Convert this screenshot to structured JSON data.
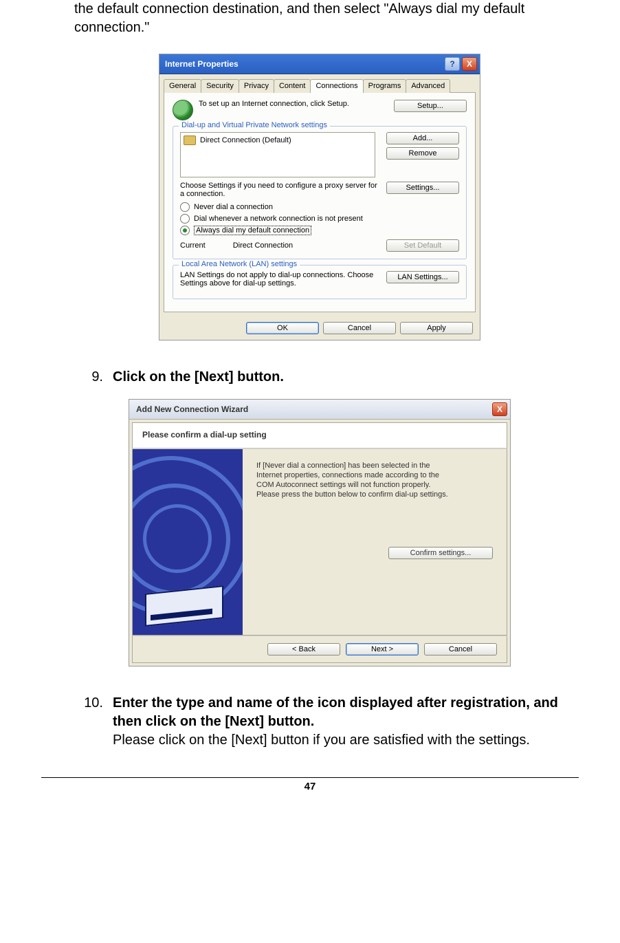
{
  "intro": "the default connection destination, and then select \"Always dial my default connection.\"",
  "step9": {
    "num": "9.",
    "text": "Click on the [Next] button."
  },
  "step10": {
    "num": "10.",
    "bold": "Enter the type and name of the icon displayed after registration, and then click on the [Next] button.",
    "plain": "Please click on the [Next] button if you are satisfied with the settings."
  },
  "dlg1": {
    "title": "Internet Properties",
    "help": "?",
    "close": "X",
    "tabs": [
      "General",
      "Security",
      "Privacy",
      "Content",
      "Connections",
      "Programs",
      "Advanced"
    ],
    "setup_text": "To set up an Internet connection, click Setup.",
    "setup_btn": "Setup...",
    "fs1_legend": "Dial-up and Virtual Private Network settings",
    "list_item": "Direct Connection (Default)",
    "add_btn": "Add...",
    "remove_btn": "Remove",
    "settings_btn": "Settings...",
    "choose_text": "Choose Settings if you need to configure a proxy server for a connection.",
    "radio1": "Never dial a connection",
    "radio2": "Dial whenever a network connection is not present",
    "radio3": "Always dial my default connection",
    "current_label": "Current",
    "current_value": "Direct Connection",
    "setdefault_btn": "Set Default",
    "fs2_legend": "Local Area Network (LAN) settings",
    "lan_text": "LAN Settings do not apply to dial-up connections. Choose Settings above for dial-up settings.",
    "lan_btn": "LAN Settings...",
    "ok": "OK",
    "cancel": "Cancel",
    "apply": "Apply"
  },
  "dlg2": {
    "title": "Add New Connection Wizard",
    "close": "X",
    "subtitle": "Please confirm a dial-up setting",
    "p1": "If [Never dial a connection] has been selected in the",
    "p2": "Internet properties, connections made according to the",
    "p3": "COM Autoconnect settings will not function properly.",
    "p4": "Please press the button below to confirm dial-up settings.",
    "confirm_btn": "Confirm settings...",
    "back": "< Back",
    "next": "Next >",
    "cancel": "Cancel"
  },
  "page_number": "47"
}
